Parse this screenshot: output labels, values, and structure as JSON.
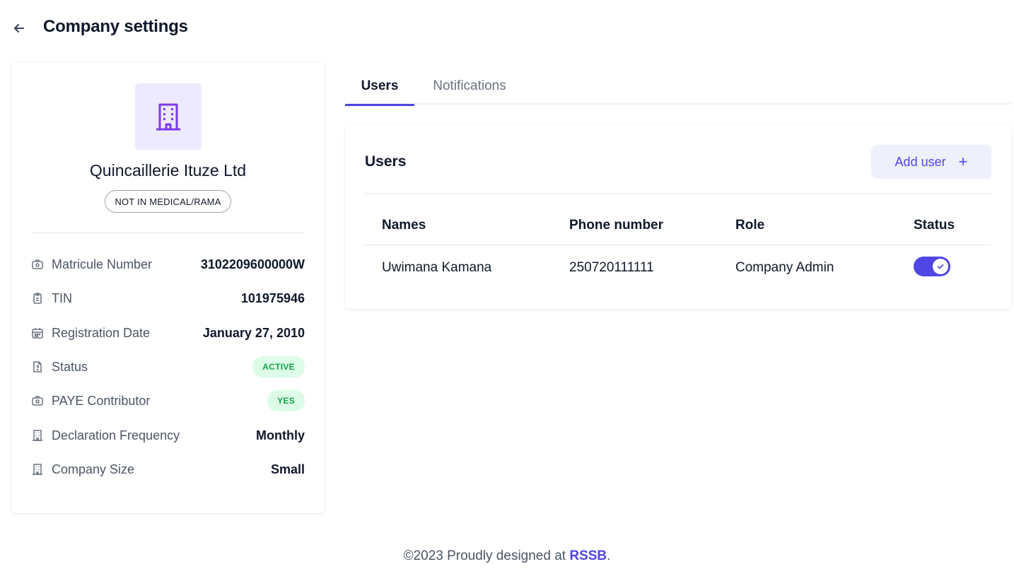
{
  "header": {
    "title": "Company settings"
  },
  "company": {
    "name": "Quincaillerie Ituze Ltd",
    "medical_badge": "NOT IN MEDICAL/RAMA",
    "details": [
      {
        "label": "Matricule Number",
        "value": "3102209600000W",
        "icon": "id-card-icon"
      },
      {
        "label": "TIN",
        "value": "101975946",
        "icon": "clipboard-icon"
      },
      {
        "label": "Registration Date",
        "value": "January 27, 2010",
        "icon": "calendar-icon"
      },
      {
        "label": "Status",
        "value": "ACTIVE",
        "icon": "document-icon"
      },
      {
        "label": "PAYE Contributor",
        "value": "YES",
        "icon": "id-card-icon"
      },
      {
        "label": "Declaration Frequency",
        "value": "Monthly",
        "icon": "building-icon"
      },
      {
        "label": "Company Size",
        "value": "Small",
        "icon": "building-icon"
      }
    ]
  },
  "tabs": [
    {
      "label": "Users",
      "active": true
    },
    {
      "label": "Notifications",
      "active": false
    }
  ],
  "users_panel": {
    "title": "Users",
    "add_button": "Add user",
    "add_icon": "+",
    "columns": [
      "Names",
      "Phone number",
      "Role",
      "Status"
    ],
    "rows": [
      {
        "name": "Uwimana Kamana",
        "phone": "250720111111",
        "role": "Company Admin",
        "status_enabled": true
      }
    ]
  },
  "footer": {
    "prefix": "©2023 Proudly designed at ",
    "link": "RSSB",
    "suffix": "."
  },
  "colors": {
    "accent": "#4f46e5",
    "accent_light": "#ede9fe",
    "success_bg": "#dcfce7",
    "success_text": "#16a34a"
  }
}
